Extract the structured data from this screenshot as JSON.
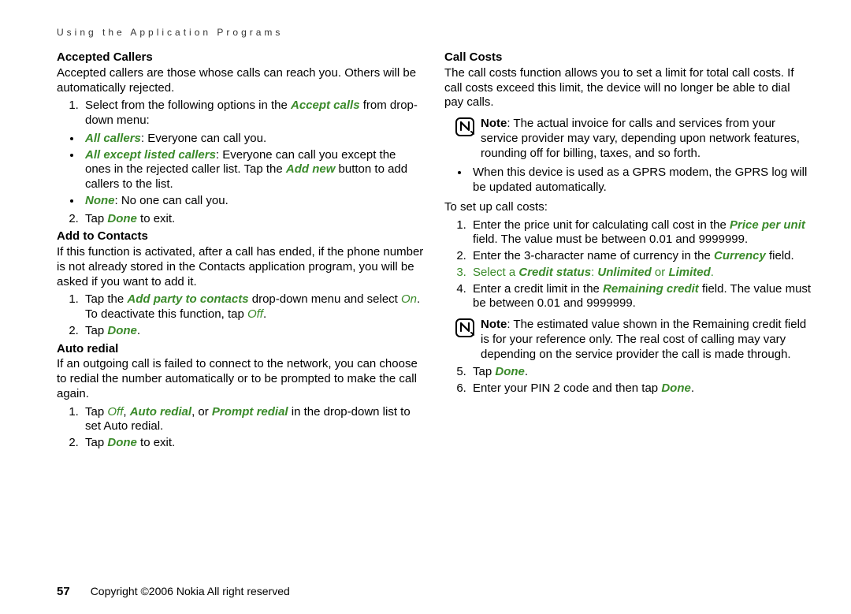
{
  "header": "Using the Application Programs",
  "left": {
    "accepted": {
      "title": "Accepted Callers",
      "intro": "Accepted callers are those whose calls can reach you. Others will be automatically rejected.",
      "step1_pre": "Select from the following options in the ",
      "accept_calls": "Accept calls",
      "step1_post": " from drop-down menu:",
      "opt_all_pre": "All callers",
      "opt_all_post": ": Everyone can call you.",
      "opt_except_pre": "All except listed callers",
      "opt_except_mid": ": Everyone can call you except the ones in the rejected caller list. Tap the ",
      "add_new": "Add new",
      "opt_except_post": " button to add callers to the list.",
      "opt_none_pre": "None",
      "opt_none_post": ": No one can call you.",
      "step2_pre": "Tap ",
      "done1": "Done",
      "step2_post": " to exit."
    },
    "add_contacts": {
      "title": "Add to Contacts",
      "intro": "If this function is activated, after a call has ended, if the phone number is not already stored in the Contacts application program, you will be asked if you want to add it.",
      "step1_pre": "Tap the ",
      "add_party": "Add party to contacts",
      "step1_mid": " drop-down menu and select ",
      "on": "On",
      "step1_mid2": ". To deactivate this function, tap ",
      "off": "Off",
      "step1_post": ".",
      "step2_pre": "Tap ",
      "done2": "Done",
      "step2_post": "."
    },
    "auto_redial": {
      "title": "Auto redial",
      "intro": "If an outgoing call is failed to connect to the network, you can choose to redial the number automatically or to be prompted to make the call again.",
      "step1_pre": "Tap ",
      "off2": "Off",
      "sep1": ", ",
      "auto": "Auto redial",
      "sep2": ", or ",
      "prompt": "Prompt redial",
      "step1_post": " in the drop-down list to set Auto redial.",
      "step2_pre": "Tap ",
      "done3": "Done",
      "step2_post": " to exit."
    }
  },
  "right": {
    "call_costs": {
      "title": "Call Costs",
      "intro": "The call costs function allows you to set a limit for total call costs. If call costs exceed this limit, the device will no longer be able to dial pay calls.",
      "note1_pre": "Note",
      "note1_body": ": The actual invoice for calls and services from your service provider may vary, depending upon network features, rounding off for billing, taxes, and so forth.",
      "bullet1": "When this device is used as a GPRS modem, the GPRS log will be updated automatically.",
      "setup": "To set up call costs:",
      "s1_pre": "Enter the price unit for calculating call cost in the ",
      "price_per_unit": "Price per unit",
      "s1_post": " field. The value must be between 0.01 and 9999999.",
      "s2_pre": "Enter the 3-character name of currency in the ",
      "currency": "Currency",
      "s2_post": " field.",
      "s3_pre": "Select a ",
      "credit_status": "Credit status",
      "s3_sep": ": ",
      "unlimited": "Unlimited",
      "s3_or": " or ",
      "limited": "Limited",
      "s3_post": ".",
      "s4_pre": "Enter a credit limit in the ",
      "remaining_credit": "Remaining credit",
      "s4_post": " field. The value must be between 0.01 and 9999999.",
      "note2_pre": "Note",
      "note2_body": ": The estimated value shown in the Remaining credit field is for your reference only. The real cost of calling may vary depending on the service provider the call is made through.",
      "s5_pre": "Tap ",
      "done4": "Done",
      "s5_post": ".",
      "s6_pre": "Enter your PIN 2 code and then tap ",
      "done5": "Done",
      "s6_post": "."
    }
  },
  "footer": {
    "page": "57",
    "copyright": "Copyright ©2006 Nokia All right reserved"
  }
}
